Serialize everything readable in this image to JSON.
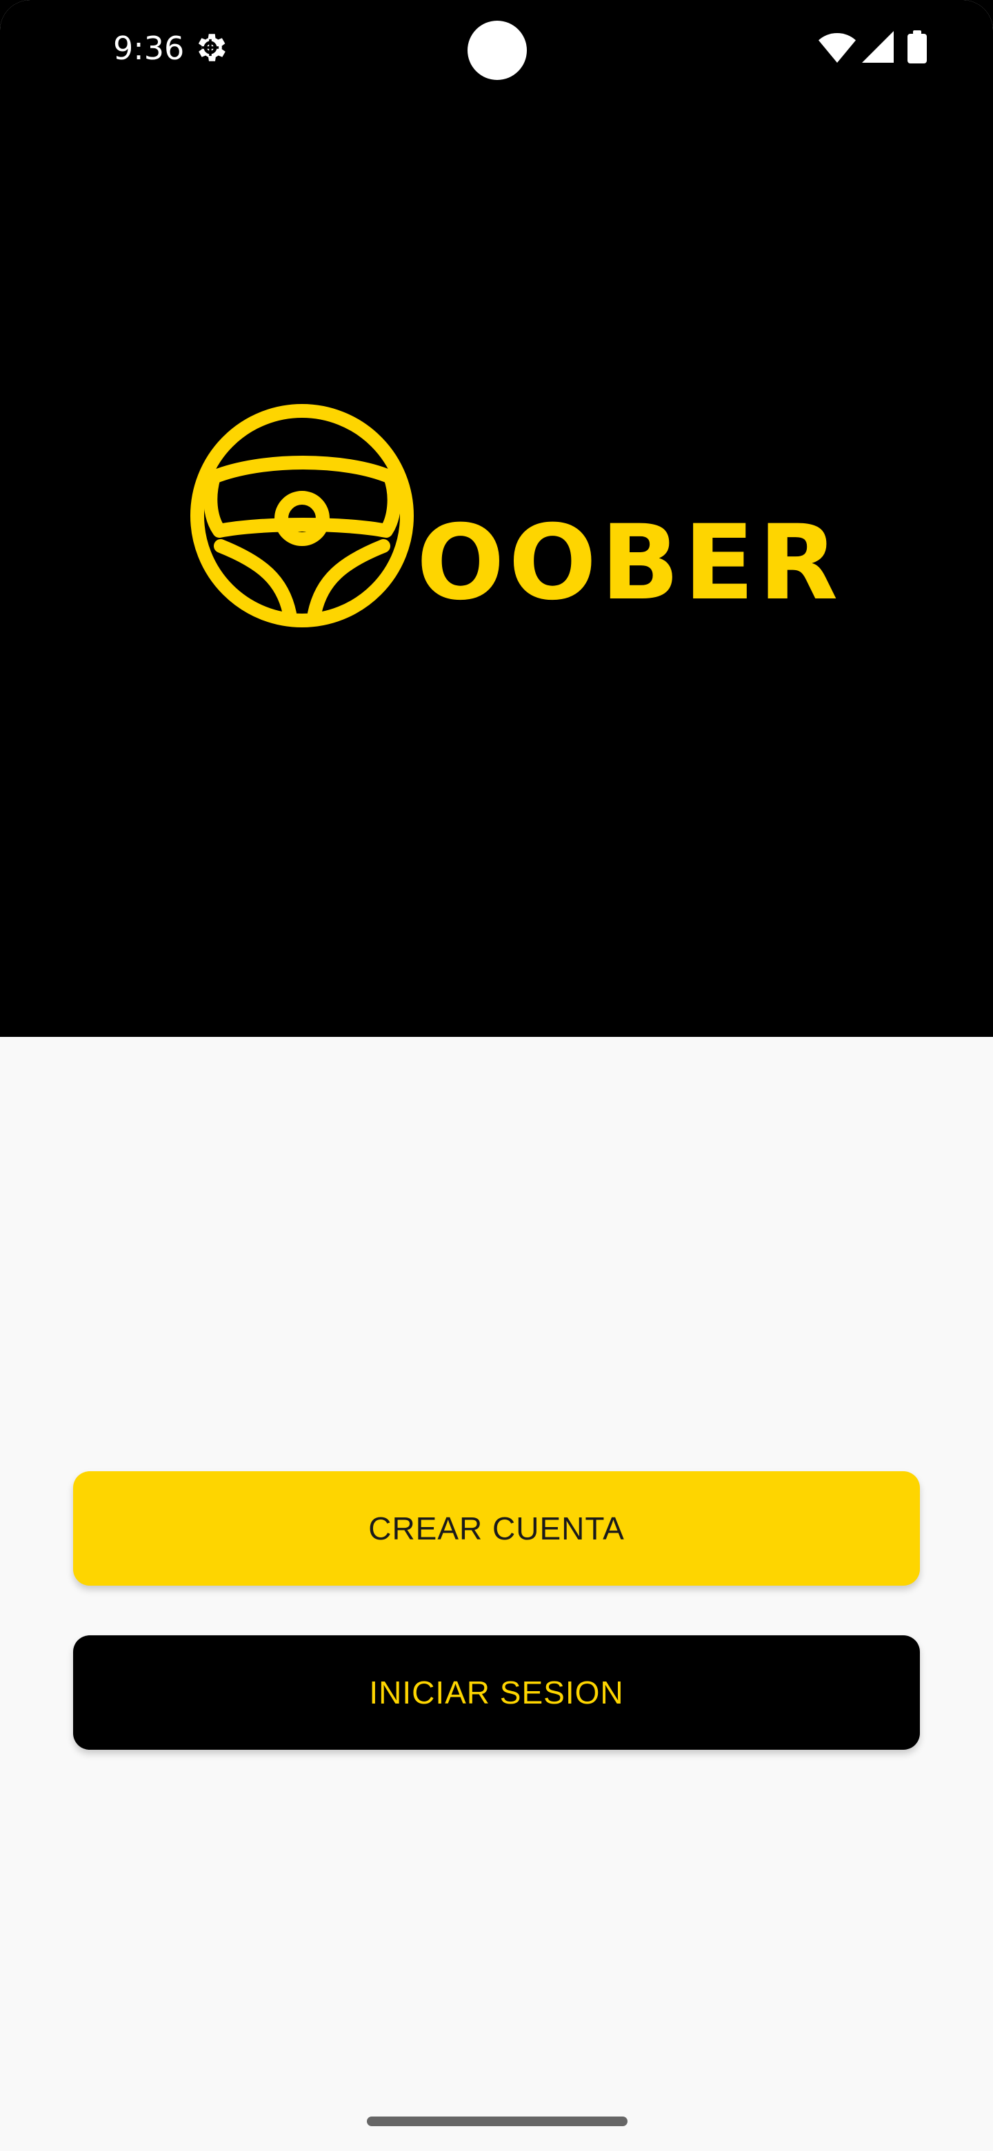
{
  "status_bar": {
    "time": "9:36",
    "icons": [
      "settings-icon",
      "wifi-icon",
      "signal-icon",
      "battery-icon"
    ]
  },
  "logo": {
    "text": "OOBER",
    "icon": "steering-wheel-icon",
    "color": "#fed500"
  },
  "buttons": {
    "create_account": "CREAR CUENTA",
    "login": "INICIAR SESION"
  },
  "colors": {
    "accent": "#fed500",
    "hero_background": "#000000",
    "page_background": "#f9f9f9"
  }
}
